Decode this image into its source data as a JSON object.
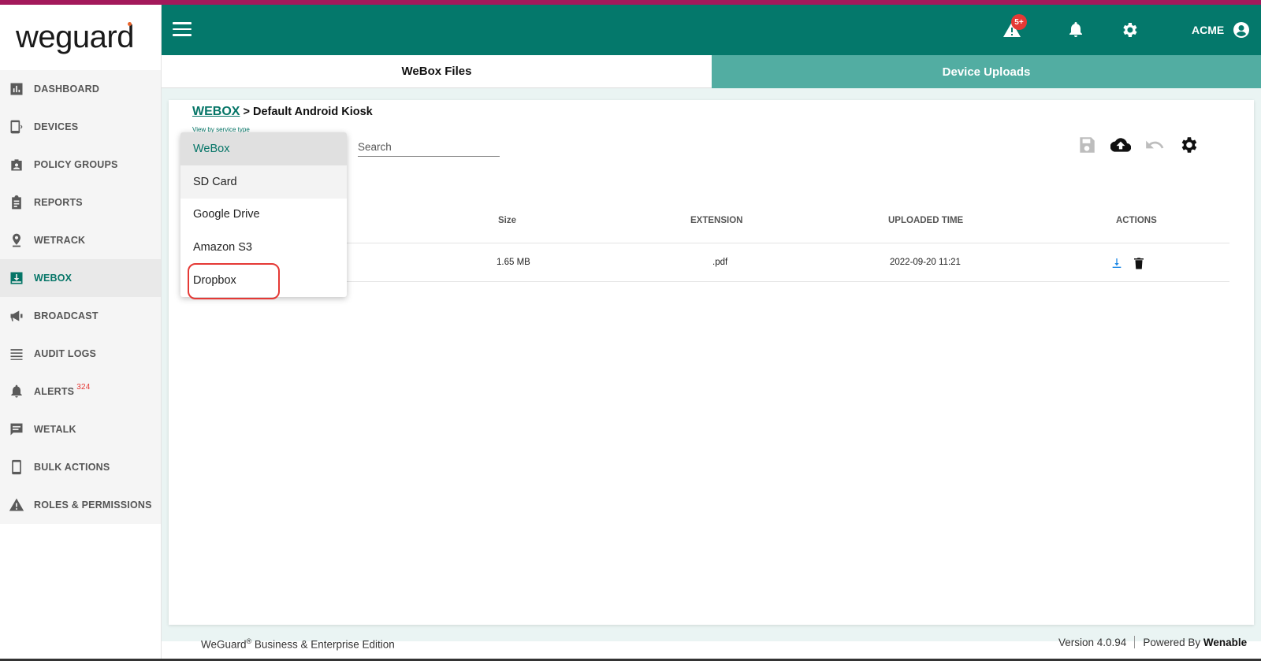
{
  "app": {
    "logo_text": "weguard"
  },
  "sidebar": {
    "items": [
      {
        "label": "DASHBOARD",
        "icon": "bar-chart-icon"
      },
      {
        "label": "DEVICES",
        "icon": "device-icon"
      },
      {
        "label": "POLICY GROUPS",
        "icon": "badge-icon"
      },
      {
        "label": "REPORTS",
        "icon": "clipboard-icon"
      },
      {
        "label": "WETRACK",
        "icon": "location-pin-icon"
      },
      {
        "label": "WEBOX",
        "icon": "inbox-download-icon",
        "active": true
      },
      {
        "label": "BROADCAST",
        "icon": "megaphone-icon"
      },
      {
        "label": "AUDIT LOGS",
        "icon": "list-icon"
      },
      {
        "label": "ALERTS",
        "icon": "bell-alert-icon",
        "badge": "324"
      },
      {
        "label": "WETALK",
        "icon": "chat-icon"
      },
      {
        "label": "BULK ACTIONS",
        "icon": "phone-icon"
      },
      {
        "label": "ROLES & PERMISSIONS",
        "icon": "warning-icon"
      }
    ]
  },
  "header": {
    "alert_badge": "5+",
    "user_name": "ACME"
  },
  "tabs": {
    "webox_files": "WeBox Files",
    "device_uploads": "Device Uploads"
  },
  "breadcrumb": {
    "root": "WEBOX",
    "separator": " > ",
    "current": "Default Android Kiosk"
  },
  "filter": {
    "label": "View by service type"
  },
  "search": {
    "placeholder": "Search"
  },
  "table": {
    "headers": {
      "size": "Size",
      "extension": "EXTENSION",
      "uploaded_time": "UPLOADED TIME",
      "actions": "ACTIONS"
    },
    "rows": [
      {
        "size": "1.65 MB",
        "extension": ".pdf",
        "uploaded_time": "2022-09-20 11:21"
      }
    ]
  },
  "dropdown": {
    "options": [
      "WeBox",
      "SD Card",
      "Google Drive",
      "Amazon S3",
      "Dropbox"
    ],
    "selected": "WeBox"
  },
  "footer": {
    "brand": "WeGuard",
    "reg": "®",
    "edition": " Business & Enterprise Edition",
    "version": "Version 4.0.94",
    "powered_prefix": "Powered By ",
    "powered_by": "Wenable"
  },
  "colors": {
    "primary": "#04786b",
    "tab_inactive": "#52ada2",
    "accent_stripe": "#a3195b",
    "highlight": "#e53935"
  }
}
